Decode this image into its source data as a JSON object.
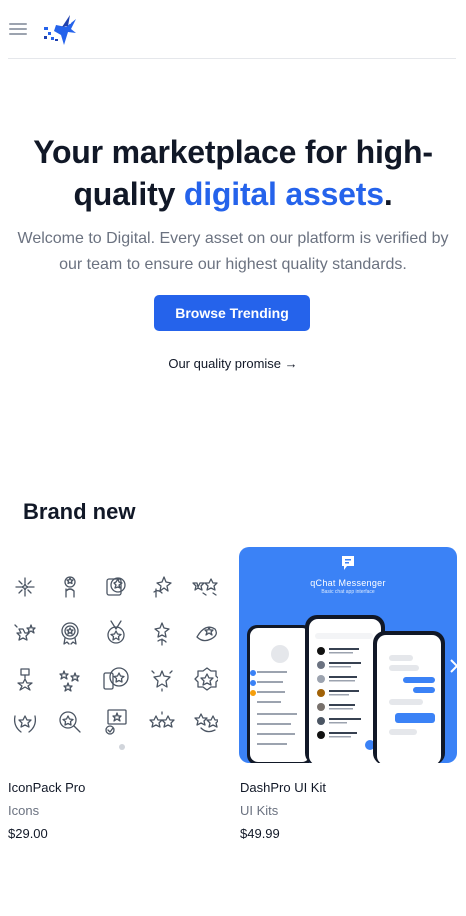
{
  "header": {
    "menu_icon": "hamburger-icon",
    "logo_icon": "hummingbird-logo-icon"
  },
  "hero": {
    "title_part1": "Your marketplace for high-quality ",
    "title_accent": "digital assets",
    "title_end": ".",
    "subtitle": "Welcome to Digital. Every asset on our platform is verified by our team to ensure our highest quality standards.",
    "cta_label": "Browse Trending",
    "promise_link": "Our quality promise →"
  },
  "section": {
    "title": "Brand new"
  },
  "products": [
    {
      "name": "IconPack Pro",
      "category": "Icons",
      "price": "$29.00"
    },
    {
      "name": "DashPro UI Kit",
      "category": "UI Kits",
      "price": "$49.99",
      "thumb_title": "qChat Messenger",
      "thumb_tagline": "Basic chat app interface"
    }
  ],
  "colors": {
    "accent": "#2563eb",
    "card_blue": "#3b82f6",
    "muted": "#6b7280"
  }
}
